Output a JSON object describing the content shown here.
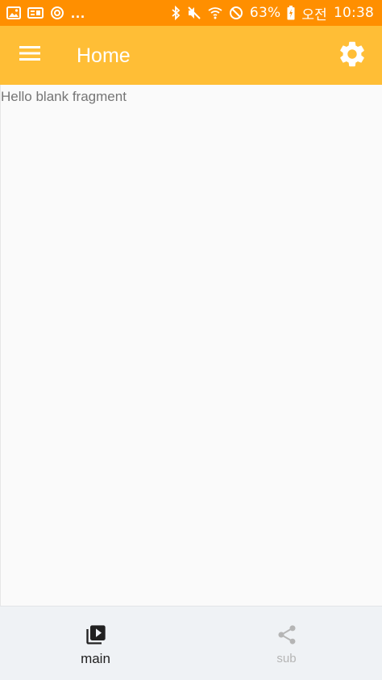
{
  "status_bar": {
    "left_icons": [
      "image-icon",
      "gallery-app-icon",
      "sync-icon"
    ],
    "overflow": "...",
    "right_icons": [
      "bluetooth-icon",
      "mute-icon",
      "wifi-icon",
      "do-not-disturb-icon"
    ],
    "battery": "63%",
    "ampm": "오전",
    "time": "10:38",
    "background": "#ff8f00"
  },
  "app_bar": {
    "title": "Home",
    "menu_icon": "hamburger-menu-icon",
    "settings_icon": "gear-icon",
    "background": "#ffbe36"
  },
  "content": {
    "text": "Hello blank fragment"
  },
  "bottom_nav": {
    "items": [
      {
        "label": "main",
        "icon": "video-library-icon",
        "active": true
      },
      {
        "label": "sub",
        "icon": "share-icon",
        "active": false
      }
    ],
    "active_color": "#212121",
    "inactive_color": "#b5b5b5"
  }
}
